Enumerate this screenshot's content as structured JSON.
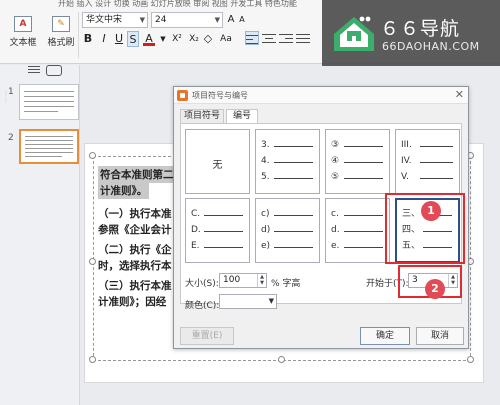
{
  "toolbar": {
    "top_text": "开始 插入 设计 切换 动画 幻灯片放映 审阅 视图 开发工具 特色功能",
    "textbox_label": "文本框",
    "format_brush_label": "格式刷",
    "font_name": "华文中宋",
    "font_size": "24",
    "bold": "B",
    "italic": "I",
    "underline": "U",
    "strike": "S",
    "font_color": "A",
    "superscript": "X²",
    "subscript": "X₂",
    "clear": "◇",
    "char_spacing": "Aa"
  },
  "logo": {
    "title": "６６导航",
    "subtitle": "66DAOHAN.COM"
  },
  "slides_panel": {
    "items": [
      {
        "num": "1"
      },
      {
        "num": "2"
      }
    ]
  },
  "document": {
    "lines": [
      "符合本准则第二",
      "计准则》。",
      "（一）执行本准",
      "参照《企业会计",
      "（二）执行《企",
      "时，选择执行本",
      "（三）执行本准",
      "计准则》；因经"
    ]
  },
  "dialog": {
    "title": "项目符号与编号",
    "tabs": [
      {
        "label": "项目符号"
      },
      {
        "label": "编号"
      }
    ],
    "grid": [
      {
        "none_label": "无"
      },
      {
        "items": [
          "3.",
          "4.",
          "5."
        ]
      },
      {
        "items": [
          "③",
          "④",
          "⑤"
        ]
      },
      {
        "items": [
          "III.",
          "IV.",
          "V."
        ]
      },
      {
        "items": [
          "C.",
          "D.",
          "E."
        ]
      },
      {
        "items": [
          "c)",
          "d)",
          "e)"
        ]
      },
      {
        "items": [
          "c.",
          "d.",
          "e."
        ]
      },
      {
        "items": [
          "三、",
          "四、",
          "五、"
        ]
      }
    ],
    "size_label": "大小(S):",
    "size_value": "100",
    "size_unit": "% 字高",
    "start_label": "开始于(T):",
    "start_value": "3",
    "color_label": "颜色(C):",
    "color_value": "",
    "reset_label": "重置(E)",
    "ok_label": "确定",
    "cancel_label": "取消"
  },
  "annotations": {
    "badge1": "1",
    "badge2": "2",
    "color": "#e02b32"
  }
}
